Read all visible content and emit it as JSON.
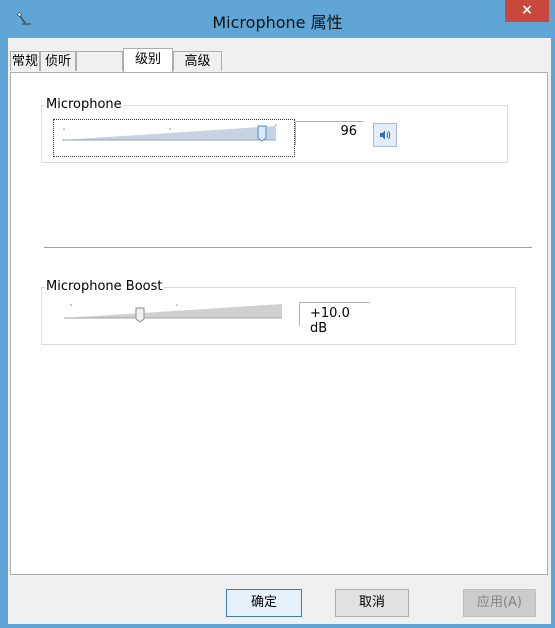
{
  "window": {
    "title": "Microphone 属性",
    "close_symbol": "×"
  },
  "tabs": [
    {
      "label": "常规",
      "active": false
    },
    {
      "label": "侦听",
      "active": false
    },
    {
      "label": "级别",
      "active": true
    },
    {
      "label": "高级",
      "active": false
    }
  ],
  "microphone": {
    "label": "Microphone",
    "value": "96",
    "level_fraction": 0.96
  },
  "boost": {
    "label": "Microphone Boost",
    "value": "+10.0 dB",
    "level_fraction": 0.33
  },
  "buttons": {
    "ok": "确定",
    "cancel": "取消",
    "apply": "应用(A)"
  },
  "colors": {
    "titlebar": "#5fa6d6",
    "close": "#c9473b",
    "accent": "#2a6fc4"
  },
  "icons": {
    "app": "microphone-icon",
    "speaker": "speaker-icon"
  }
}
